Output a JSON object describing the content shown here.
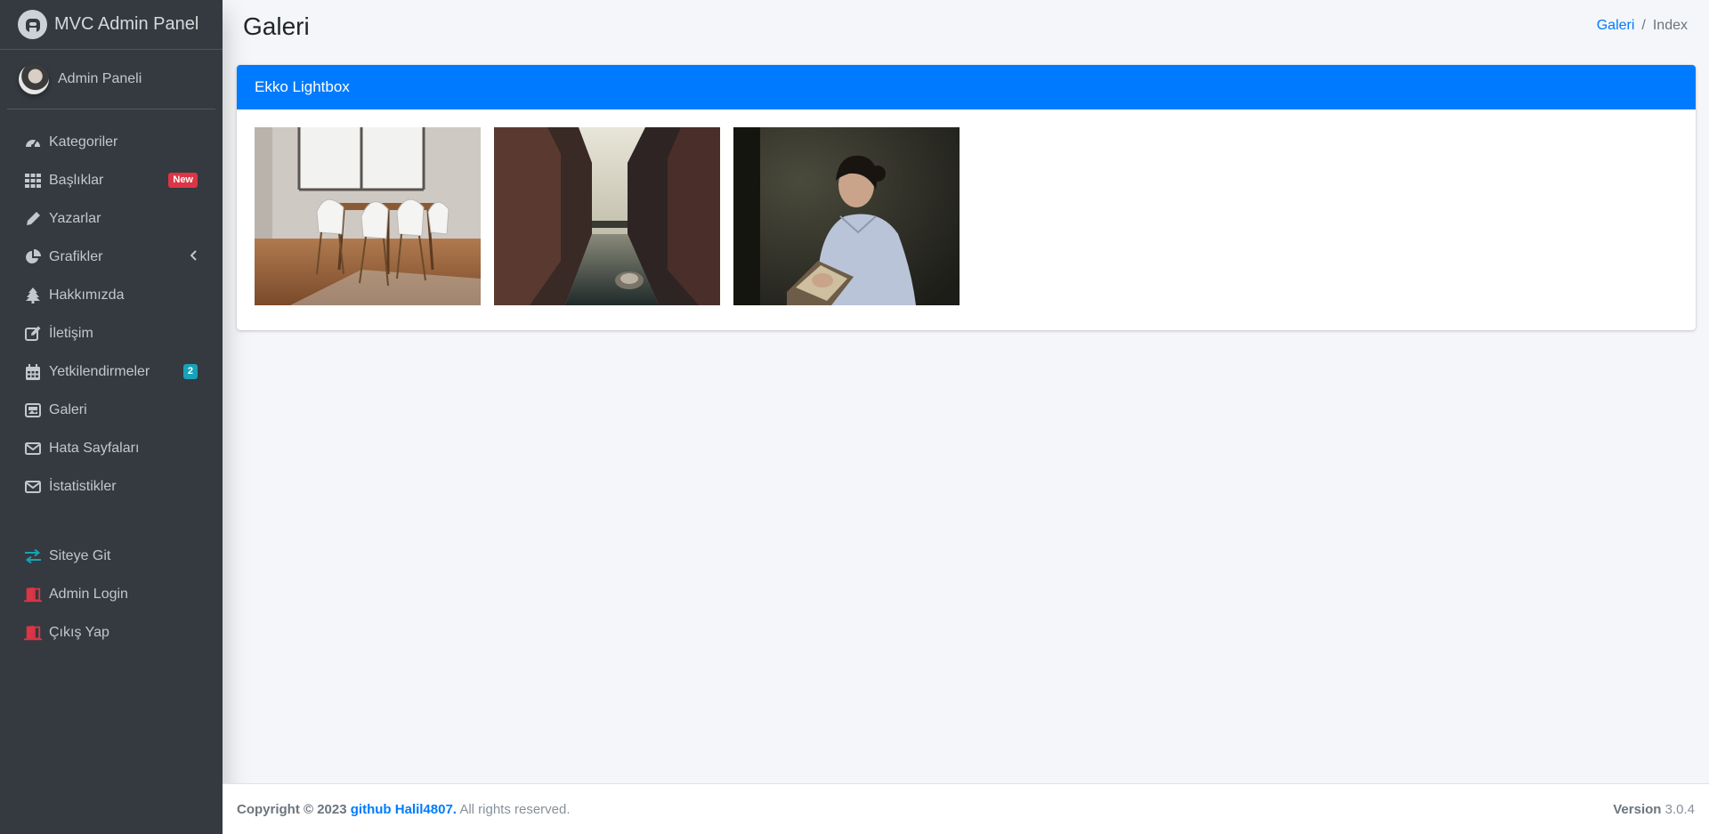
{
  "brand": {
    "title": "MVC Admin Panel"
  },
  "user": {
    "name": "Admin Paneli"
  },
  "nav": {
    "items": [
      {
        "label": "Kategoriler",
        "icon": "tachometer-icon"
      },
      {
        "label": "Başlıklar",
        "icon": "grid-icon",
        "badge": "New"
      },
      {
        "label": "Yazarlar",
        "icon": "pencil-icon"
      },
      {
        "label": "Grafikler",
        "icon": "pie-chart-icon"
      },
      {
        "label": "Hakkımızda",
        "icon": "tree-icon"
      },
      {
        "label": "İletişim",
        "icon": "edit-icon"
      },
      {
        "label": "Yetkilendirmeler",
        "icon": "calendar-icon",
        "badge": "2"
      },
      {
        "label": "Galeri",
        "icon": "image-icon"
      },
      {
        "label": "Hata Sayfaları",
        "icon": "envelope-icon"
      },
      {
        "label": "İstatistikler",
        "icon": "envelope-icon"
      }
    ],
    "bottom": [
      {
        "label": "Siteye Git",
        "icon": "exchange-icon",
        "color": "#17a2b8"
      },
      {
        "label": "Admin Login",
        "icon": "door-icon",
        "color": "#dc3545"
      },
      {
        "label": "Çıkış Yap",
        "icon": "door-icon",
        "color": "#dc3545"
      }
    ]
  },
  "header": {
    "title": "Galeri",
    "breadcrumb": {
      "link": "Galeri",
      "separator": "/",
      "current": "Index"
    }
  },
  "card": {
    "title": "Ekko Lightbox",
    "images": [
      "dining-room-photo",
      "canal-city-photo",
      "woman-reading-photo"
    ]
  },
  "footer": {
    "copyright_prefix": "Copyright © 2023",
    "link": "github Halil4807.",
    "suffix": "All rights reserved.",
    "version_label": "Version",
    "version_value": "3.0.4"
  },
  "colors": {
    "sidebar": "#343a40",
    "primary": "#007bff",
    "danger": "#dc3545",
    "info": "#17a2b8"
  }
}
